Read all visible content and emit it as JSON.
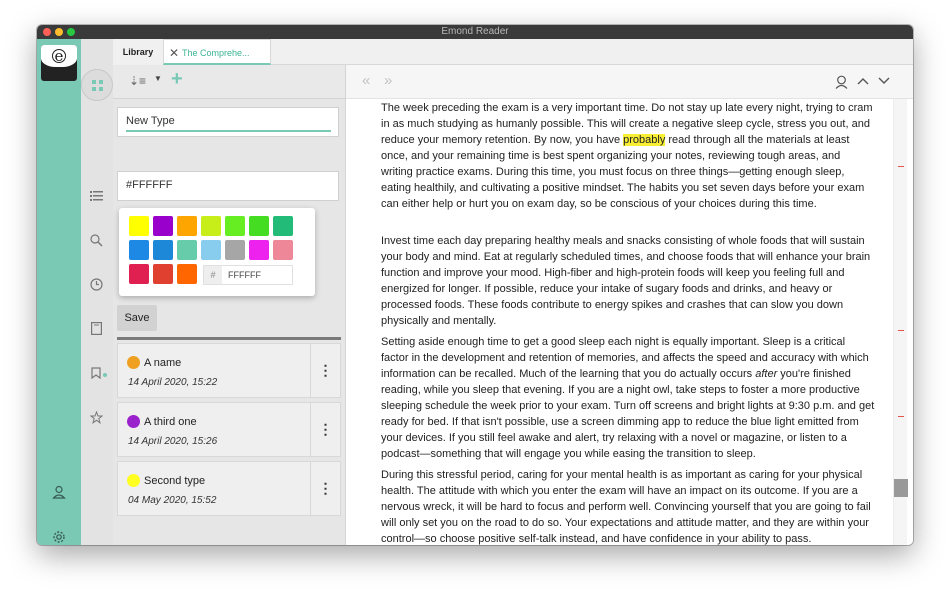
{
  "app": {
    "title": "Emond Reader",
    "logo_letter": "e"
  },
  "tabs": [
    {
      "label": "Library"
    },
    {
      "label": "The Comprehe..."
    }
  ],
  "sidebar_icons": [
    "grid-icon",
    "list-icon",
    "search-icon",
    "clock-icon",
    "bookmark-icon",
    "book-icon",
    "star-icon",
    "user-icon",
    "gear-icon"
  ],
  "library": {
    "type_name": "New Type",
    "color_value": "#FFFFFF",
    "hex_prefix": "#",
    "hex_input": "FFFFFF",
    "save_label": "Save",
    "swatches": [
      "#ffff00",
      "#9900cc",
      "#ffa500",
      "#c8ee1a",
      "#66ee22",
      "#44dd22",
      "#22bb77",
      "#1e88e5",
      "#1e88d8",
      "#66ccaa",
      "#88ccee",
      "#a6a6a6",
      "#ee22ee",
      "#ee8899",
      "#e02050",
      "#e04030",
      "#ff6600"
    ],
    "types": [
      {
        "name": "A name",
        "date": "14 April 2020, 15:22",
        "color": "#f0a020"
      },
      {
        "name": "A third one",
        "date": "14 April 2020, 15:26",
        "color": "#9922cc"
      },
      {
        "name": "Second type",
        "date": "04 May 2020, 15:52",
        "color": "#ffff22"
      }
    ]
  },
  "reader": {
    "p1_before": "The week preceding the exam is a very important time. Do not stay up late every night, trying to cram in as much studying as humanly possible. This will create a negative sleep cycle, stress you out, and reduce your memory retention. By now, you have ",
    "p1_highlight": "probably",
    "p1_after": " read through all the materials at least once, and your remaining time is best spent organizing your notes, reviewing tough areas, and writing practice exams. During this time, you must focus on three things—getting enough sleep, eating healthily, and cultivating a positive mindset. The habits you set seven days before your exam can either help or hurt you on exam day, so be conscious of your choices during this time.",
    "p2": "Invest time each day preparing healthy meals and snacks consisting of whole foods that will sustain your body and mind. Eat at regularly scheduled times, and choose foods that will enhance your brain function and improve your mood. High-fiber and high-protein foods will keep you feeling full and energized for longer. If possible, reduce your intake of sugary foods and drinks, and heavy or processed foods. These foods contribute to energy spikes and crashes that can slow you down physically and mentally.",
    "p3_before": "Setting aside enough time to get a good sleep each night is equally important. Sleep is a critical factor in the development and retention of memories, and affects the speed and accuracy with which information can be recalled. Much of the learning that you do actually occurs ",
    "p3_em": "after",
    "p3_after": " you're finished reading, while you sleep that evening. If you are a night owl, take steps to foster a more productive sleeping schedule the week prior to your exam. Turn off screens and bright lights at 9:30 p.m. and get ready for bed. If that isn't possible, use a screen dimming app to reduce the blue light emitted from your devices. If you still feel awake and alert, try relaxing with a novel or magazine, or listen to a podcast—something that will engage you while easing the transition to sleep.",
    "p4": "During this stressful period, caring for your mental health is as important as caring for your physical health. The attitude with which you enter the exam will have an impact on its outcome. If you are a nervous wreck, it will be hard to focus and perform well. Convincing yourself that you are going to fail will only set you on the road to do so. Your expectations and attitude matter, and they are within your control—so choose positive self-talk instead, and have confidence in your ability to pass."
  }
}
